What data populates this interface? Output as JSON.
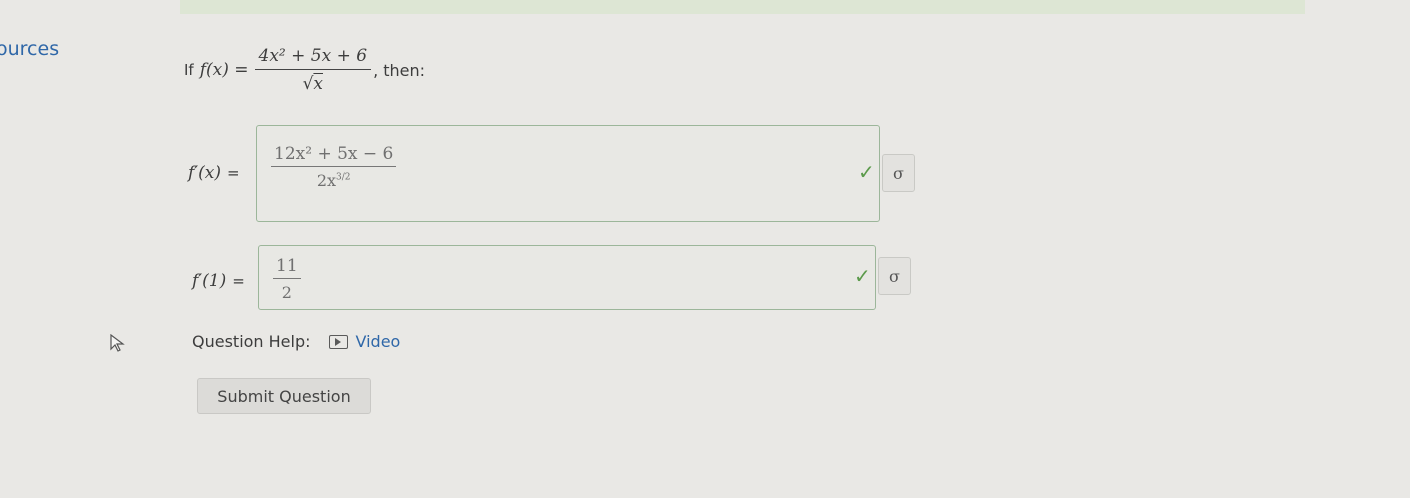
{
  "sidebar": {
    "resources_label": "ources"
  },
  "question": {
    "prefix": "If",
    "lhs": "f(x) =",
    "numerator": "4x² + 5x + 6",
    "denominator_radicand": "x",
    "suffix": ", then:"
  },
  "answers": [
    {
      "label": "f′(x)",
      "equals": "=",
      "numerator": "12x² + 5x − 6",
      "denominator_base": "2x",
      "denominator_exp_num": "3",
      "denominator_exp_den": "2",
      "status": "correct"
    },
    {
      "label": "f′(1)",
      "equals": "=",
      "numerator": "11",
      "denominator": "2",
      "status": "correct"
    }
  ],
  "status_icons": {
    "correct": "✓",
    "sigma_button": "σ"
  },
  "help": {
    "label": "Question Help:",
    "video_label": "Video"
  },
  "submit_label": "Submit Question",
  "colors": {
    "link": "#2f67a8",
    "check": "#5b9a4b",
    "box_border": "#9cb69a"
  }
}
